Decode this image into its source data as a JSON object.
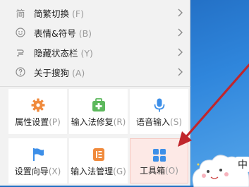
{
  "menu": {
    "items": [
      {
        "icon": "simplified-traditional-icon",
        "glyph": "简",
        "label": "简繁切换",
        "shortcut": "(F)"
      },
      {
        "icon": "emoji-icon",
        "glyph": "☺",
        "label": "表情&符号",
        "shortcut": "(B)"
      },
      {
        "icon": "hide-statusbar-icon",
        "glyph": "≈",
        "label": "隐藏状态栏",
        "shortcut": "(Y)"
      },
      {
        "icon": "help-icon",
        "glyph": "?",
        "label": "关于搜狗",
        "shortcut": "(A)"
      }
    ]
  },
  "tools": {
    "tiles": [
      {
        "name": "properties-settings",
        "icon": "gear-icon",
        "color": "#f08a3c",
        "label": "属性设置",
        "shortcut": "(P)"
      },
      {
        "name": "ime-repair",
        "icon": "repair-kit-icon",
        "color": "#5cb85c",
        "label": "输入法修复",
        "shortcut": "(R)"
      },
      {
        "name": "voice-input",
        "icon": "microphone-icon",
        "color": "#3d8fe8",
        "label": "语音输入",
        "shortcut": "(S)"
      },
      {
        "name": "setup-wizard",
        "icon": "flag-icon",
        "color": "#3d8fe8",
        "label": "设置向导",
        "shortcut": "(X)"
      },
      {
        "name": "ime-manager",
        "icon": "list-icon",
        "color": "#f08a3c",
        "label": "输入法管理",
        "shortcut": "(G)"
      },
      {
        "name": "toolbox",
        "icon": "grid-icon",
        "color": "#3d8fe8",
        "label": "工具箱",
        "shortcut": "(O)",
        "selected": true
      }
    ]
  },
  "desktop": {
    "sticker_char": "中"
  },
  "colors": {
    "annotation_arrow": "#c0262c"
  }
}
